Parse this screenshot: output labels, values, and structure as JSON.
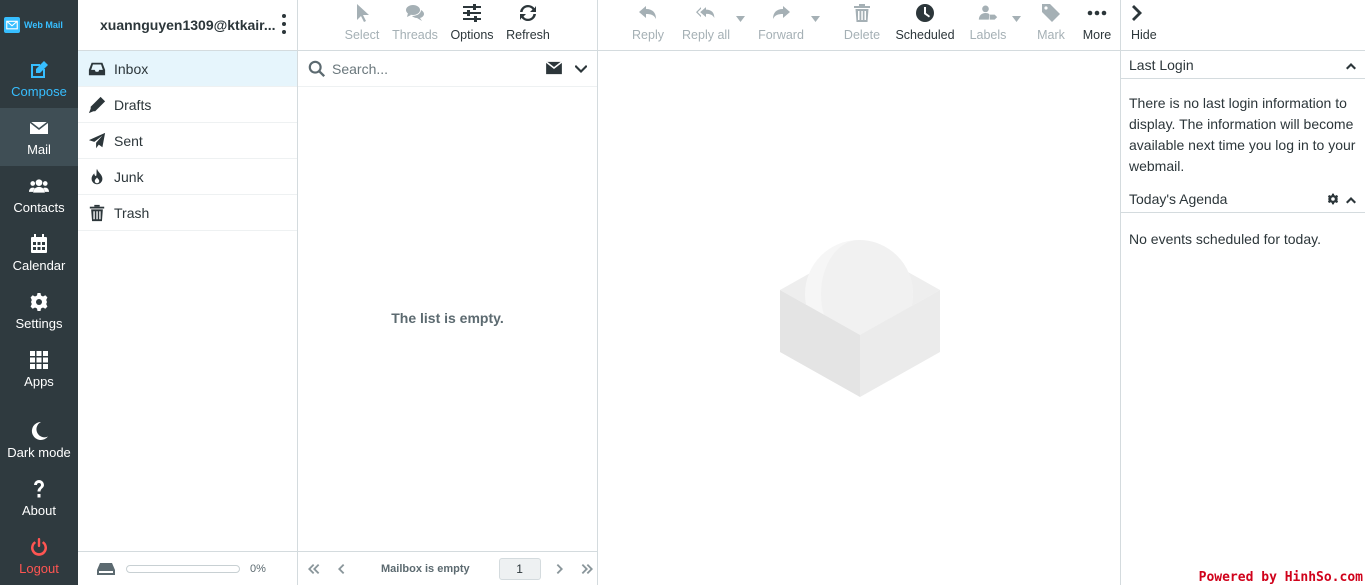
{
  "brand": {
    "logo_text": "Web Mail",
    "accent": "#37beff"
  },
  "nav": {
    "items": [
      {
        "label": "Compose",
        "icon": "compose-icon"
      },
      {
        "label": "Mail",
        "icon": "envelope-icon"
      },
      {
        "label": "Contacts",
        "icon": "users-icon"
      },
      {
        "label": "Calendar",
        "icon": "calendar-icon"
      },
      {
        "label": "Settings",
        "icon": "gear-icon"
      },
      {
        "label": "Apps",
        "icon": "grid-icon"
      },
      {
        "label": "Dark mode",
        "icon": "moon-icon"
      },
      {
        "label": "About",
        "icon": "question-icon"
      },
      {
        "label": "Logout",
        "icon": "power-icon"
      }
    ]
  },
  "account": {
    "email": "xuannguyen1309@ktkair..."
  },
  "folders": [
    {
      "label": "Inbox",
      "icon": "inbox-icon"
    },
    {
      "label": "Drafts",
      "icon": "pencil-icon"
    },
    {
      "label": "Sent",
      "icon": "paper-plane-icon"
    },
    {
      "label": "Junk",
      "icon": "fire-icon"
    },
    {
      "label": "Trash",
      "icon": "trash-icon"
    }
  ],
  "quota": {
    "text": "0%"
  },
  "list_toolbar": {
    "select": "Select",
    "threads": "Threads",
    "options": "Options",
    "refresh": "Refresh"
  },
  "search": {
    "placeholder": "Search..."
  },
  "message_list": {
    "empty_text": "The list is empty."
  },
  "list_footer": {
    "status": "Mailbox is empty",
    "page": "1"
  },
  "message_toolbar": {
    "reply": "Reply",
    "reply_all": "Reply all",
    "forward": "Forward",
    "delete": "Delete",
    "scheduled": "Scheduled",
    "labels": "Labels",
    "mark": "Mark",
    "more": "More"
  },
  "sidebar": {
    "hide": "Hide",
    "last_login_title": "Last Login",
    "last_login_text": "There is no last login information to display. The information will become available next time you log in to your webmail.",
    "agenda_title": "Today's Agenda",
    "agenda_text": "No events scheduled for today."
  },
  "watermark": "Powered by HinhSo.com"
}
